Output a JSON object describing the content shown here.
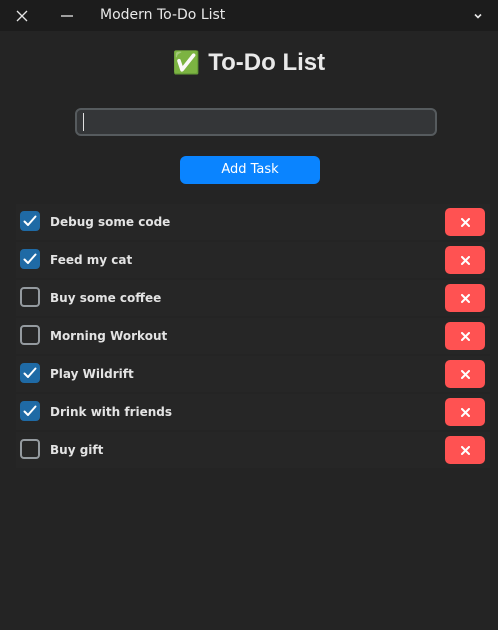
{
  "window": {
    "title": "Modern To-Do List"
  },
  "header": {
    "icon": "✅",
    "title": "To-Do List"
  },
  "input": {
    "value": "",
    "placeholder": ""
  },
  "add_button": {
    "label": "Add Task"
  },
  "tasks": [
    {
      "label": "Debug some code",
      "done": true
    },
    {
      "label": "Feed my cat",
      "done": true
    },
    {
      "label": "Buy some coffee",
      "done": false
    },
    {
      "label": "Morning Workout",
      "done": false
    },
    {
      "label": "Play Wildrift",
      "done": true
    },
    {
      "label": "Drink with friends",
      "done": true
    },
    {
      "label": "Buy gift",
      "done": false
    }
  ],
  "icons": {
    "close": "close-icon",
    "minimize": "minimize-icon",
    "menu": "chevron-down-icon",
    "check": "check-icon",
    "delete": "x-icon"
  },
  "colors": {
    "background": "#242424",
    "titlebar": "#1c1c1c",
    "accent": "#0a84ff",
    "checkbox_checked": "#1f6aa5",
    "delete": "#ff5252"
  }
}
